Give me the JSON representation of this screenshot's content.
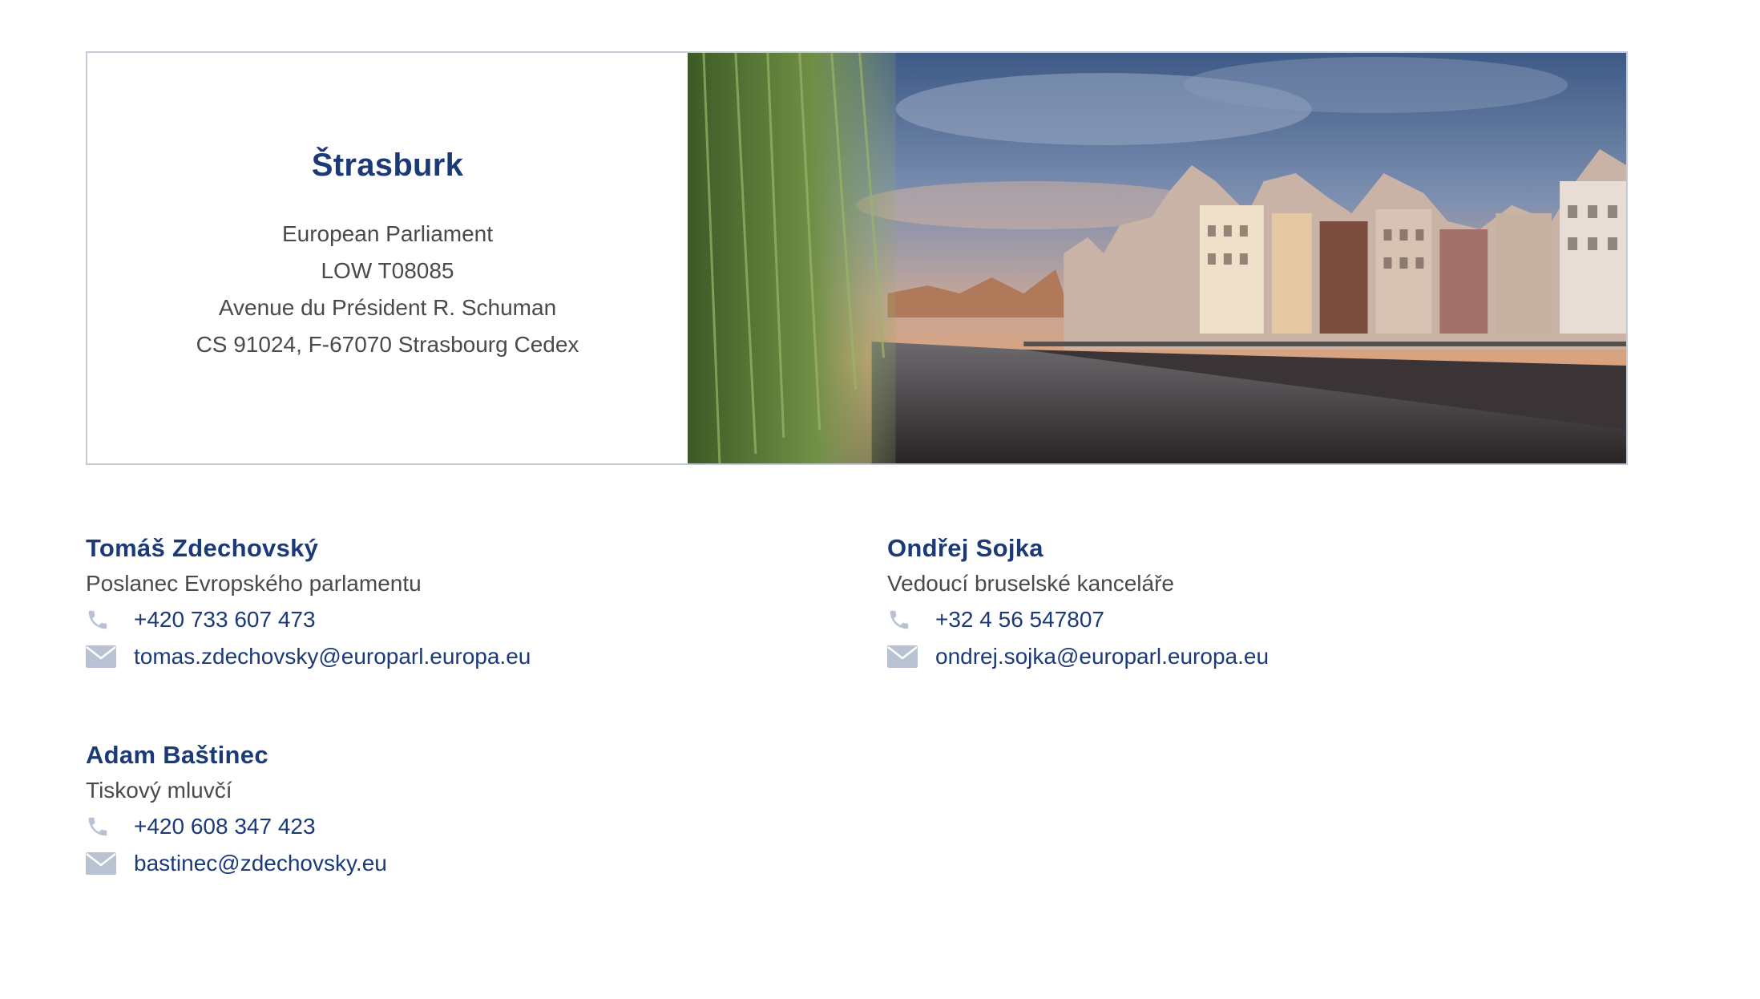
{
  "office": {
    "city": "Štrasburk",
    "address_lines": [
      "European Parliament",
      "LOW T08085",
      "Avenue du Président R. Schuman",
      "CS 91024, F-67070 Strasbourg Cedex"
    ]
  },
  "contacts": [
    {
      "name": "Tomáš Zdechovský",
      "role": "Poslanec Evropského parlamentu",
      "phone": "+420 733 607 473",
      "email": "tomas.zdechovsky@europarl.europa.eu"
    },
    {
      "name": "Ondřej Sojka",
      "role": "Vedoucí bruselské kanceláře",
      "phone": "+32 4 56 547807",
      "email": "ondrej.sojka@europarl.europa.eu"
    },
    {
      "name": "Adam Baštinec",
      "role": "Tiskový mluvčí",
      "phone": "+420 608 347 423",
      "email": "bastinec@zdechovsky.eu"
    }
  ],
  "icons": {
    "phone": "phone-icon",
    "email": "envelope-icon"
  },
  "colors": {
    "accent": "#1c3a78",
    "text": "#4a4a4a",
    "icon": "#b8c2d3",
    "border": "#c3cad6"
  }
}
